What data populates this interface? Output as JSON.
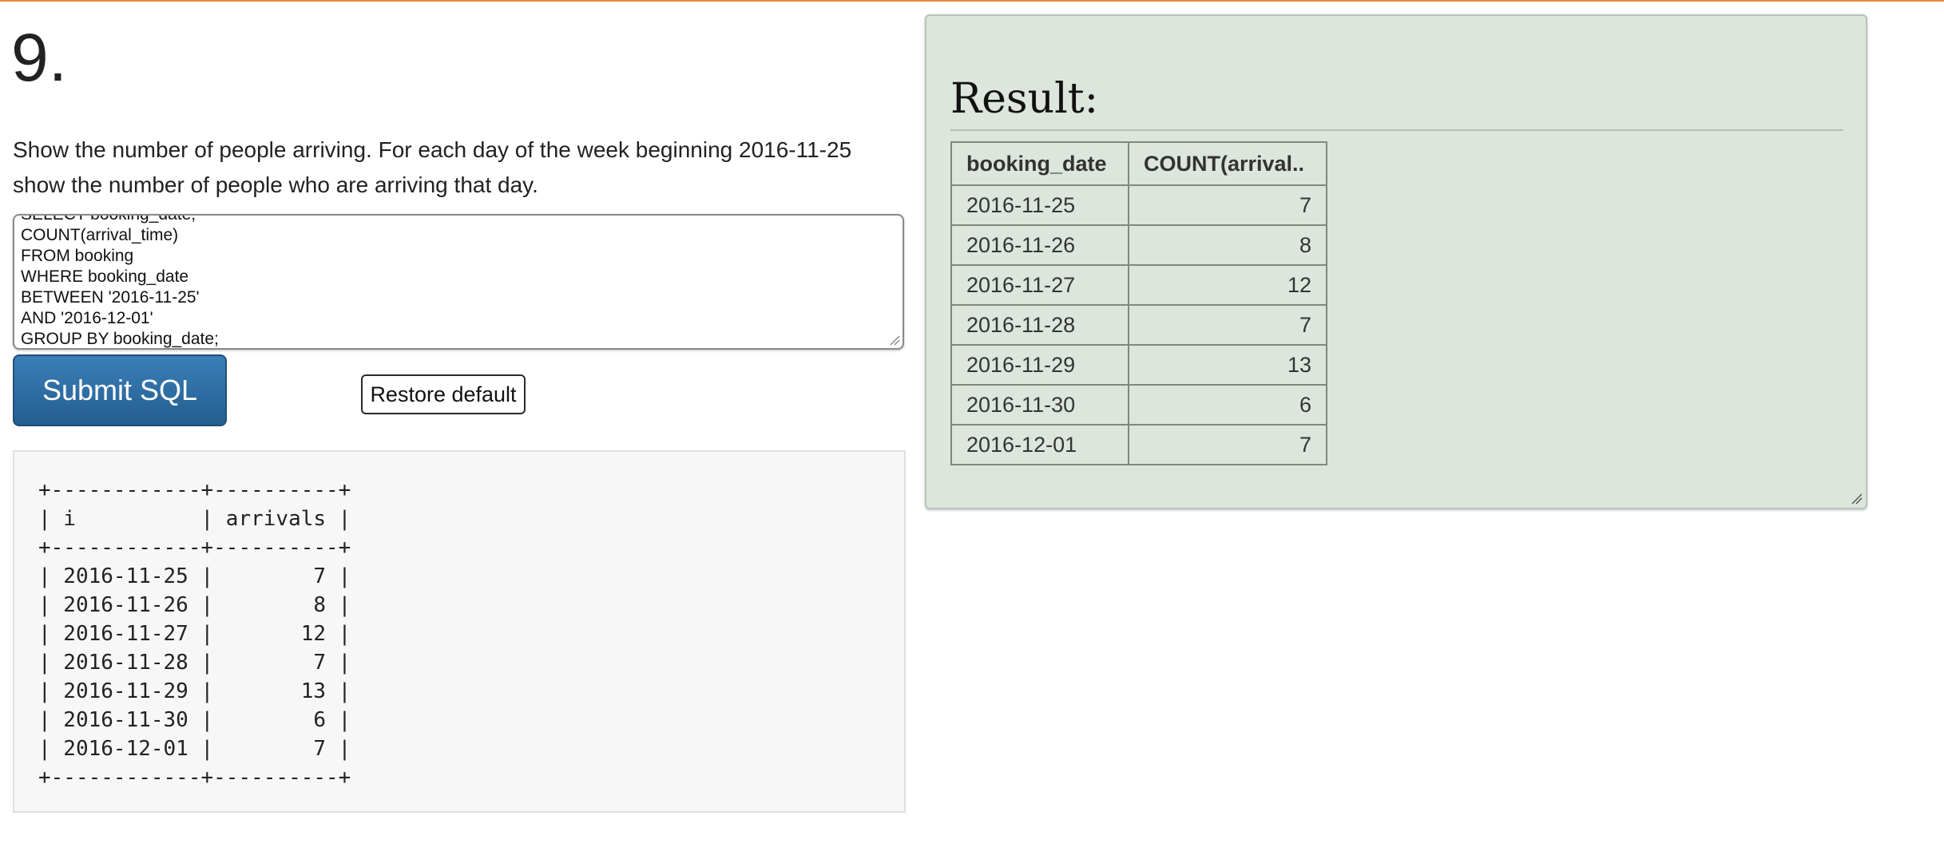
{
  "question": {
    "number": "9.",
    "text": "Show the number of people arriving. For each day of the week beginning 2016-11-25 show the number of people who are arriving that day."
  },
  "editor": {
    "sql": "SELECT booking_date,\nCOUNT(arrival_time)\nFROM booking\nWHERE booking_date\nBETWEEN '2016-11-25'\nAND '2016-12-01'\nGROUP BY booking_date;"
  },
  "buttons": {
    "submit_label": "Submit SQL",
    "restore_label": "Restore default"
  },
  "expected": {
    "ascii": "+------------+----------+\n| i          | arrivals |\n+------------+----------+\n| 2016-11-25 |        7 |\n| 2016-11-26 |        8 |\n| 2016-11-27 |       12 |\n| 2016-11-28 |        7 |\n| 2016-11-29 |       13 |\n| 2016-11-30 |        6 |\n| 2016-12-01 |        7 |\n+------------+----------+"
  },
  "result": {
    "title": "Result:",
    "headers": [
      "booking_date",
      "COUNT(arrival.."
    ],
    "rows": [
      [
        "2016-11-25",
        "7"
      ],
      [
        "2016-11-26",
        "8"
      ],
      [
        "2016-11-27",
        "12"
      ],
      [
        "2016-11-28",
        "7"
      ],
      [
        "2016-11-29",
        "13"
      ],
      [
        "2016-11-30",
        "6"
      ],
      [
        "2016-12-01",
        "7"
      ]
    ]
  },
  "colors": {
    "accent_rule": "#e8863a",
    "submit_button": "#2f6fa5",
    "result_panel": "#dce6dc",
    "expected_box": "#f7f7f7"
  }
}
